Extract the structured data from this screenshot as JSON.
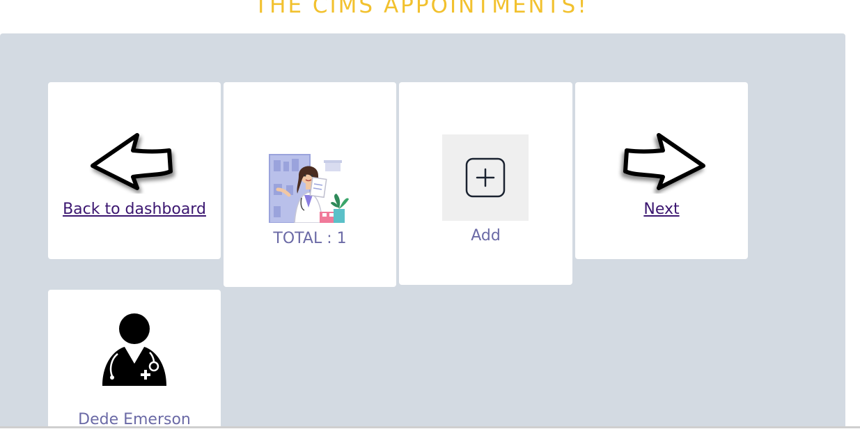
{
  "header": {
    "title": "THE CIMS APPOINTMENTS!"
  },
  "cards": {
    "back": {
      "label": "Back to dashboard",
      "icon": "arrow-left-icon"
    },
    "total": {
      "label": "TOTAL : 1",
      "icon": "pharmacist-illustration-icon"
    },
    "add": {
      "label": "Add",
      "icon": "plus-square-icon"
    },
    "next": {
      "label": "Next",
      "icon": "arrow-right-icon"
    }
  },
  "doctors": [
    {
      "name": "Dede Emerson",
      "icon": "doctor-avatar-icon"
    }
  ],
  "colors": {
    "title": "#f2c12e",
    "panel": "#d3dae2",
    "link": "#3b1670",
    "label": "#6b6aa6"
  }
}
